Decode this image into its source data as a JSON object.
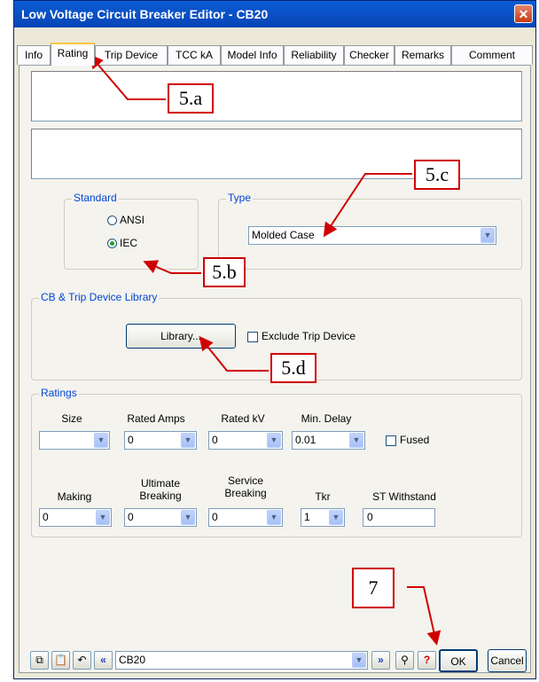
{
  "window": {
    "title": "Low Voltage Circuit Breaker Editor - CB20",
    "close_glyph": "✕"
  },
  "tabs": [
    {
      "label": "Info"
    },
    {
      "label": "Rating"
    },
    {
      "label": "Trip Device"
    },
    {
      "label": "TCC kA"
    },
    {
      "label": "Model Info"
    },
    {
      "label": "Reliability"
    },
    {
      "label": "Checker"
    },
    {
      "label": "Remarks"
    },
    {
      "label": "Comment"
    }
  ],
  "active_tab": "Rating",
  "standard": {
    "label": "Standard",
    "options": [
      {
        "label": "ANSI",
        "selected": false
      },
      {
        "label": "IEC",
        "selected": true
      }
    ]
  },
  "type": {
    "label": "Type",
    "value": "Molded Case"
  },
  "library": {
    "label": "CB & Trip Device Library",
    "button": "Library...",
    "exclude_label": "Exclude Trip Device",
    "exclude_checked": false
  },
  "ratings": {
    "label": "Ratings",
    "row1": [
      {
        "label": "Size",
        "value": ""
      },
      {
        "label": "Rated Amps",
        "value": "0"
      },
      {
        "label": "Rated kV",
        "value": "0"
      },
      {
        "label": "Min. Delay",
        "value": "0.01"
      }
    ],
    "fused_label": "Fused",
    "fused_checked": false,
    "row2": [
      {
        "label": "Making",
        "value": "0"
      },
      {
        "label": "Ultimate\nBreaking",
        "value": "0"
      },
      {
        "label": "Service\nBreaking",
        "value": "0"
      },
      {
        "label": "Tkr",
        "value": "1"
      },
      {
        "label": "ST Withstand",
        "value": "0"
      }
    ]
  },
  "bottom": {
    "id_value": "CB20",
    "ok": "OK",
    "cancel": "Cancel",
    "help_glyph": "?"
  },
  "annotations": [
    "5.a",
    "5.b",
    "5.c",
    "5.d",
    "7"
  ],
  "colors": {
    "annotation": "#d00000",
    "group_label": "#0046d5",
    "titlebar": "#0b5cd5"
  }
}
